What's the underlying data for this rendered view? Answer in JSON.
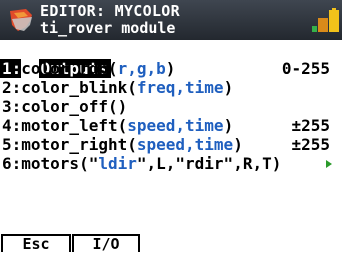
{
  "header": {
    "title": "EDITOR: MYCOLOR",
    "subtitle": "ti_rover module",
    "logo_icon": "ti-calculator-logo",
    "battery_icon": "battery-icon"
  },
  "menu": {
    "heading": "Outputs",
    "selected_index": 0,
    "items": [
      {
        "num": "1:",
        "name": "color_rgb(",
        "args": "r,g,b",
        "close": ")",
        "range": "0-255"
      },
      {
        "num": "2:",
        "name": "color_blink(",
        "args": "freq,time",
        "close": ")",
        "range": ""
      },
      {
        "num": "3:",
        "name": "color_off()",
        "args": "",
        "close": "",
        "range": ""
      },
      {
        "num": "4:",
        "name": "motor_left(",
        "args": "speed,time",
        "close": ")",
        "range": "±255"
      },
      {
        "num": "5:",
        "name": "motor_right(",
        "args": "speed,time",
        "close": ")",
        "range": "±255"
      },
      {
        "num": "6:",
        "name": "motors(\"",
        "args": "ldir",
        "close": "\",L,\"rdir\",R,T)",
        "range": ""
      }
    ],
    "more_icon": "chevron-right-icon"
  },
  "softkeys": {
    "esc": "Esc",
    "io": "I/O"
  },
  "colors": {
    "highlight_blue": "#1f5fbf",
    "titlebar": "#2b3038"
  }
}
